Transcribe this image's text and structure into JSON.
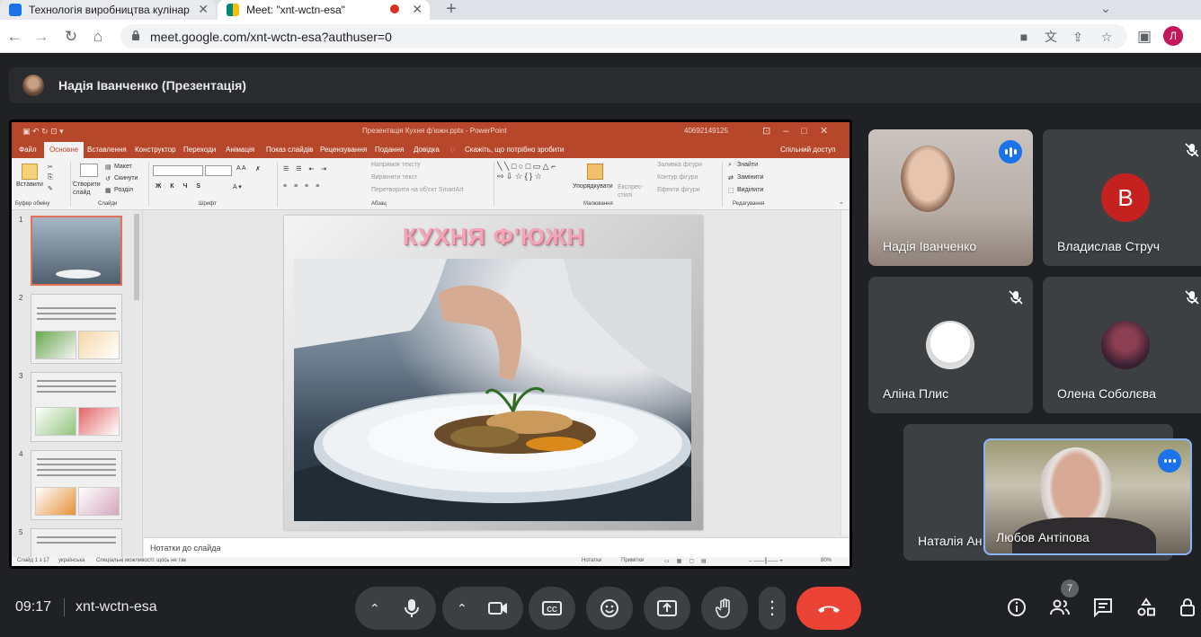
{
  "browser": {
    "tabs": [
      {
        "title": "Технологія виробництва кулінар",
        "fav_color": "#1a73e8"
      },
      {
        "title": "Meet: \"xnt-wctn-esa\"",
        "fav_color": "#00897b",
        "active": true
      }
    ],
    "url": "meet.google.com/xnt-wctn-esa?authuser=0",
    "profile_initial": "Л",
    "profile_color": "#c2185b"
  },
  "presentation": {
    "presenter_label": "Надія Іванченко (Презентація)"
  },
  "powerpoint": {
    "window_title": "Презентація Кухня ф'южн.pptx - PowerPoint",
    "user": "40692149125",
    "share": "Спільний доступ",
    "menu": [
      "Файл",
      "Основне",
      "Вставлення",
      "Конструктор",
      "Переходи",
      "Анімація",
      "Показ слайдів",
      "Рецензування",
      "Подання",
      "Довідка",
      "Скажіть, що потрібно зробити"
    ],
    "active_menu": "Основне",
    "ribbon": {
      "paste": "Вставити",
      "create_slide": "Створити слайд",
      "layout": "Макет",
      "reset": "Скинути",
      "sections": "Розділ",
      "text_direction": "Напрямок тексту",
      "align_text": "Вирівняти текст",
      "convert_smartart": "Перетворити на об'єкт SmartArt",
      "arrange": "Упорядкувати",
      "quick_styles": "Експрес-стилі",
      "shape_fill": "Заливка фігури",
      "shape_outline": "Контур фігури",
      "shape_effects": "Ефекти фігури",
      "find": "Знайти",
      "replace": "Замінити",
      "select": "Виділити",
      "groups": {
        "clipboard": "Буфер обміну",
        "slides": "Слайди",
        "font": "Шрифт",
        "paragraph": "Абзац",
        "drawing": "Малювання",
        "editing": "Редагування"
      }
    },
    "slide_title": "КУХНЯ Ф'ЮЖН",
    "thumb_numbers": [
      "1",
      "2",
      "3",
      "4",
      "5"
    ],
    "notes_placeholder": "Нотатки до слайда",
    "status": {
      "slide_count": "Слайд 1 з 17",
      "language": "українська",
      "accessibility": "Спеціальні можливості: щось не так",
      "notes": "Нотатки",
      "comments": "Примітки",
      "zoom": "80%"
    }
  },
  "participants": [
    {
      "name": "Надія Іванченко",
      "speaking": true
    },
    {
      "name": "Владислав Струч",
      "initial": "В",
      "avatar_color": "#c5221f",
      "muted": true
    },
    {
      "name": "Аліна Плис",
      "muted": true
    },
    {
      "name": "Олена Соболєва",
      "muted": true
    },
    {
      "name": "Наталія Ан"
    },
    {
      "name": "Любов Антіпова",
      "speaking": true
    }
  ],
  "bottom_bar": {
    "time": "09:17",
    "meeting_code": "xnt-wctn-esa",
    "participant_count": "7"
  },
  "colors": {
    "meet_bg": "#202124",
    "tile_bg": "#3c4043",
    "accent_blue": "#1a73e8",
    "hangup_red": "#ea4335",
    "ppt_orange": "#b7472a"
  }
}
